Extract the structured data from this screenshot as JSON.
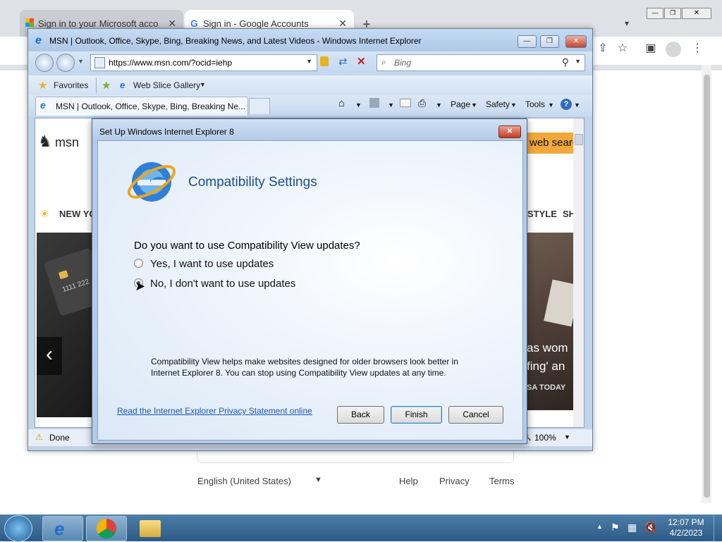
{
  "chrome": {
    "tabs": [
      {
        "label": "Sign in to your Microsoft account",
        "close": "✕"
      },
      {
        "label": "Sign in - Google Accounts",
        "close": "✕"
      }
    ],
    "new_tab": "+",
    "footer": {
      "language": "English (United States)",
      "help": "Help",
      "privacy": "Privacy",
      "terms": "Terms"
    }
  },
  "ie": {
    "title": "MSN | Outlook, Office, Skype, Bing, Breaking News, and Latest Videos - Windows Internet Explorer",
    "address": "https://www.msn.com/?ocid=iehp",
    "search_placeholder": "Bing",
    "favorites": "Favorites",
    "web_slice": "Web Slice Gallery",
    "tab_label": "MSN | Outlook, Office, Skype, Bing, Breaking Ne...",
    "commands": {
      "page": "Page",
      "safety": "Safety",
      "tools": "Tools"
    },
    "status": "Done",
    "zoom": "100%",
    "msn": {
      "logo": "msn",
      "nav_left": "NEW YO",
      "nav_right1": "STYLE",
      "nav_right2": "SH",
      "search_btn": "web searc",
      "card_number": "1111 222",
      "headline1": "as wom",
      "headline2": "fing' an",
      "source": "SA TODAY",
      "prev_arrow": "‹"
    }
  },
  "dialog": {
    "title": "Set Up Windows Internet Explorer 8",
    "heading": "Compatibility Settings",
    "question": "Do you want to use Compatibility View updates?",
    "options": [
      {
        "label": "Yes, I want to use updates",
        "selected": false
      },
      {
        "label": "No, I don't want to use updates",
        "selected": true
      }
    ],
    "description": "Compatibility View helps make websites designed for older browsers look better in Internet Explorer 8. You can stop using Compatibility View updates at any time.",
    "privacy_link": "Read the Internet Explorer Privacy Statement online",
    "buttons": {
      "back": "Back",
      "finish": "Finish",
      "cancel": "Cancel"
    }
  },
  "taskbar": {
    "time": "12:07 PM",
    "date": "4/2/2023"
  }
}
